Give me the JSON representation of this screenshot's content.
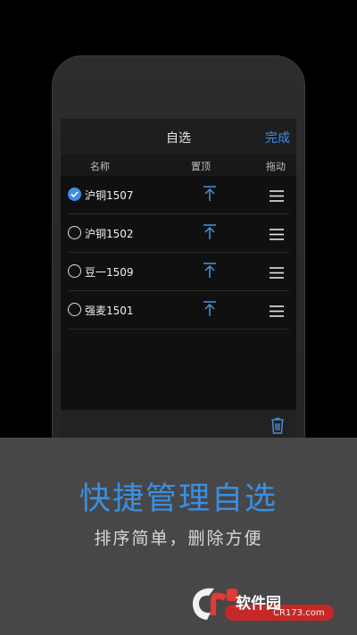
{
  "navbar": {
    "title": "自选",
    "done_label": "完成"
  },
  "columns": {
    "name": "名称",
    "top": "置顶",
    "drag": "拖动"
  },
  "rows": [
    {
      "name": "沪铜1507",
      "checked": true
    },
    {
      "name": "沪铜1502",
      "checked": false
    },
    {
      "name": "豆一1509",
      "checked": false
    },
    {
      "name": "强麦1501",
      "checked": false
    }
  ],
  "promo": {
    "headline": "快捷管理自选",
    "subline": "排序简单，删除方便"
  },
  "watermark": {
    "brand": "软件园",
    "url": "CR173.com"
  },
  "colors": {
    "accent": "#3e8ee8",
    "panel": "#474747",
    "screen": "#101010"
  },
  "icons": [
    "checkmark-icon",
    "pin-to-top-icon",
    "drag-handle-icon",
    "trash-icon"
  ]
}
